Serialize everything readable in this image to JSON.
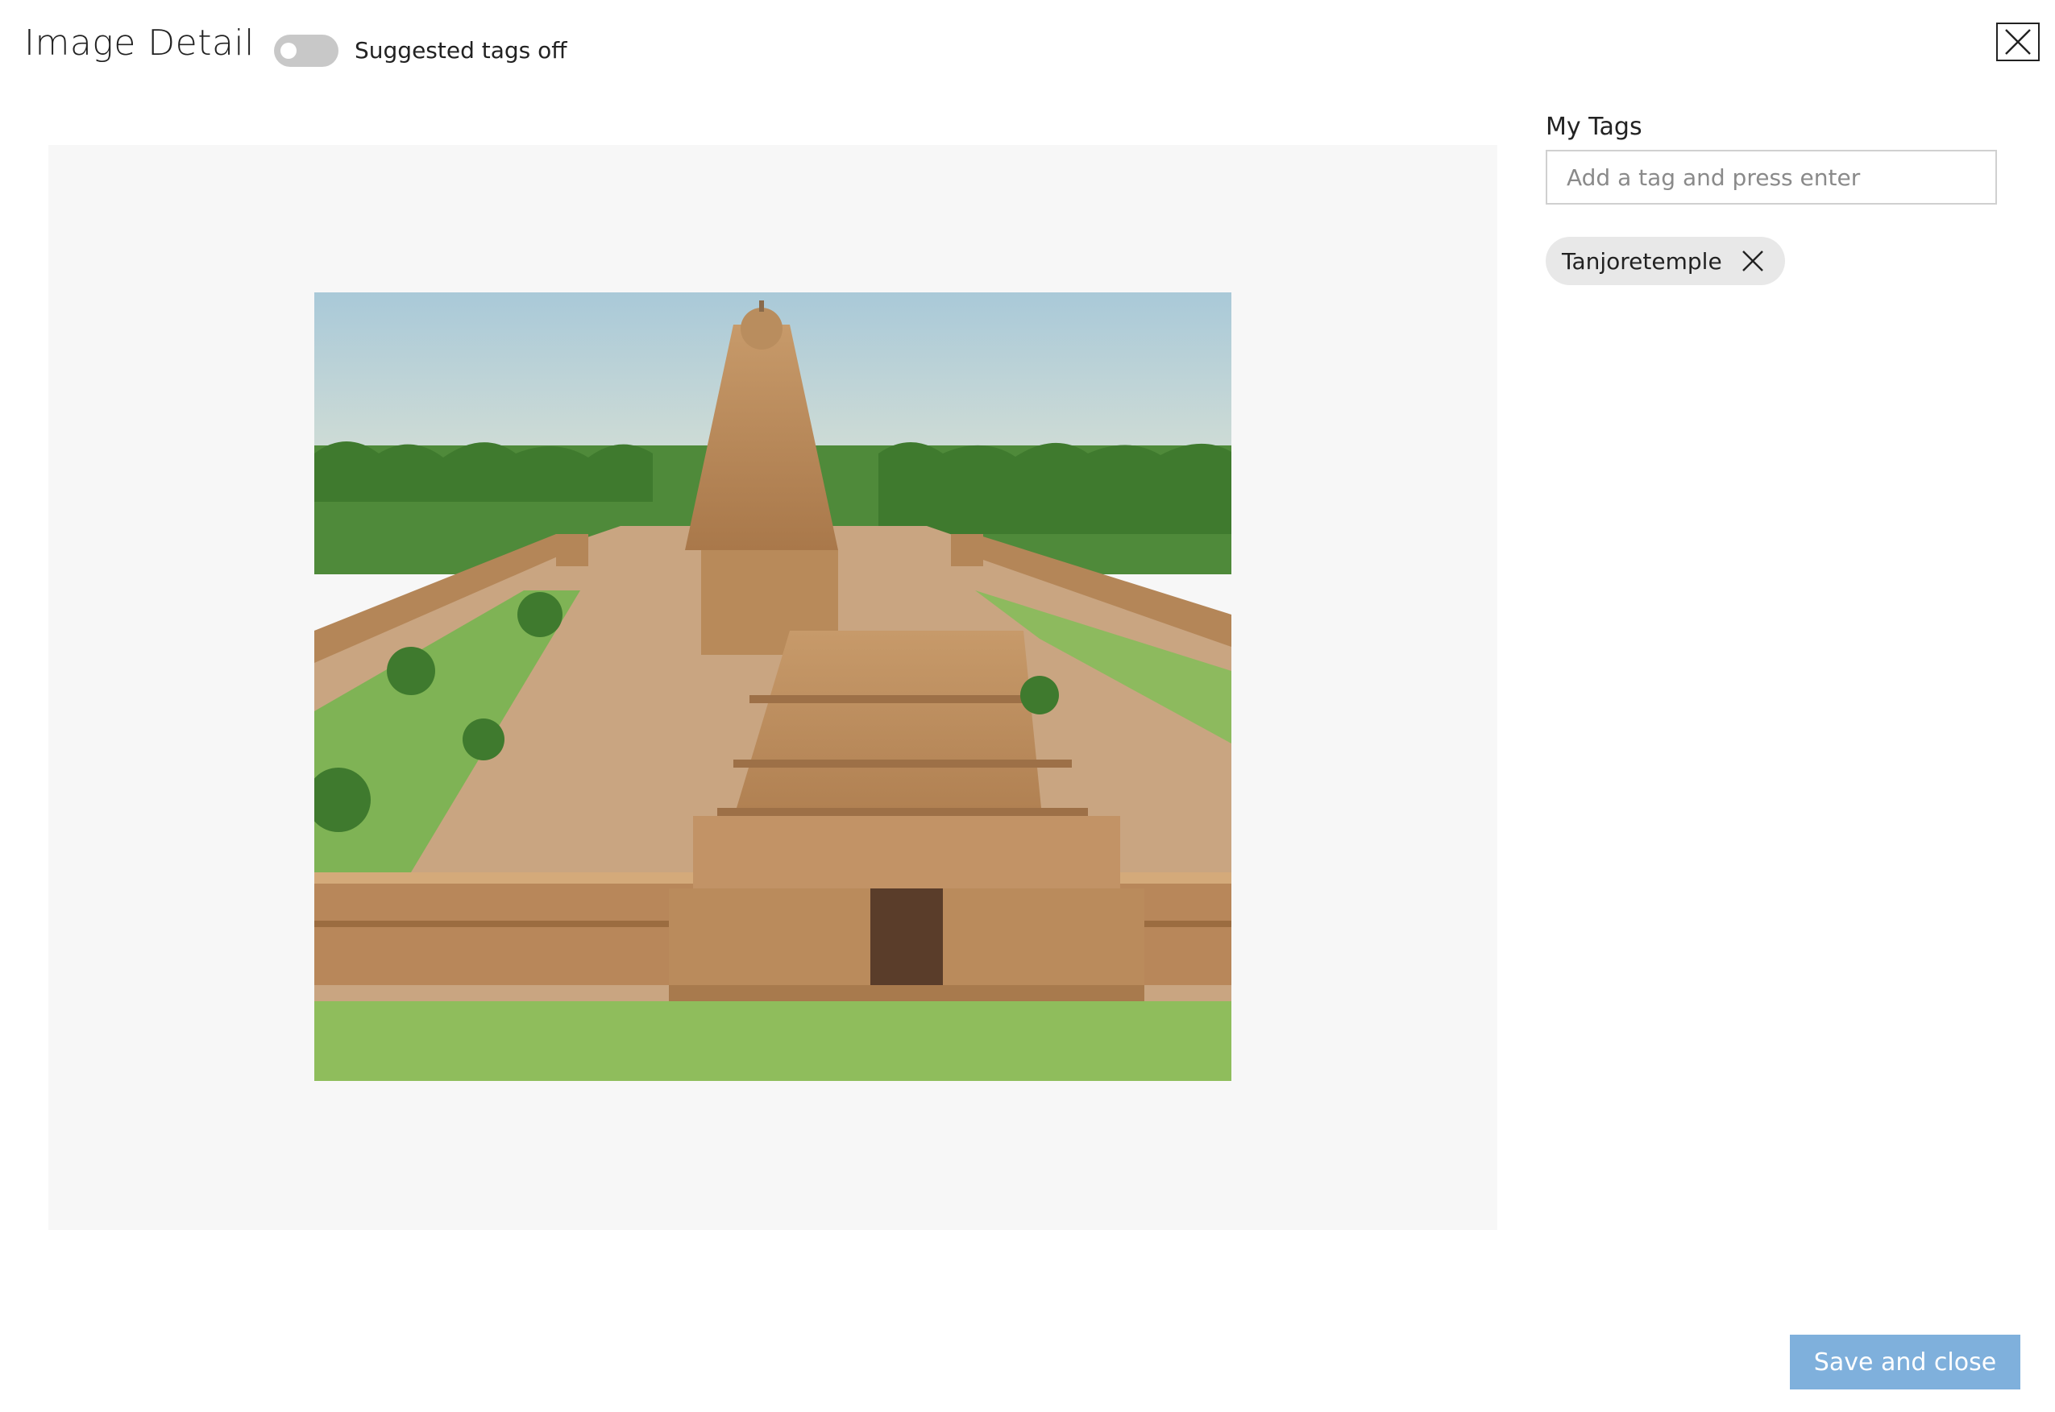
{
  "header": {
    "title": "Image Detail",
    "toggle_label": "Suggested tags off",
    "toggle_on": false,
    "close_icon": "close-icon"
  },
  "image": {
    "subject": "temple-photo"
  },
  "tags_panel": {
    "label": "My Tags",
    "input_placeholder": "Add a tag and press enter",
    "input_value": "",
    "tags": [
      {
        "label": "Tanjoretemple",
        "remove_icon": "close-icon"
      }
    ]
  },
  "footer": {
    "save_label": "Save and close"
  },
  "colors": {
    "accent": "#7fb0dc",
    "panel_bg": "#f7f7f7",
    "chip_bg": "#e8e8e8",
    "toggle_off": "#c8c8c8"
  }
}
